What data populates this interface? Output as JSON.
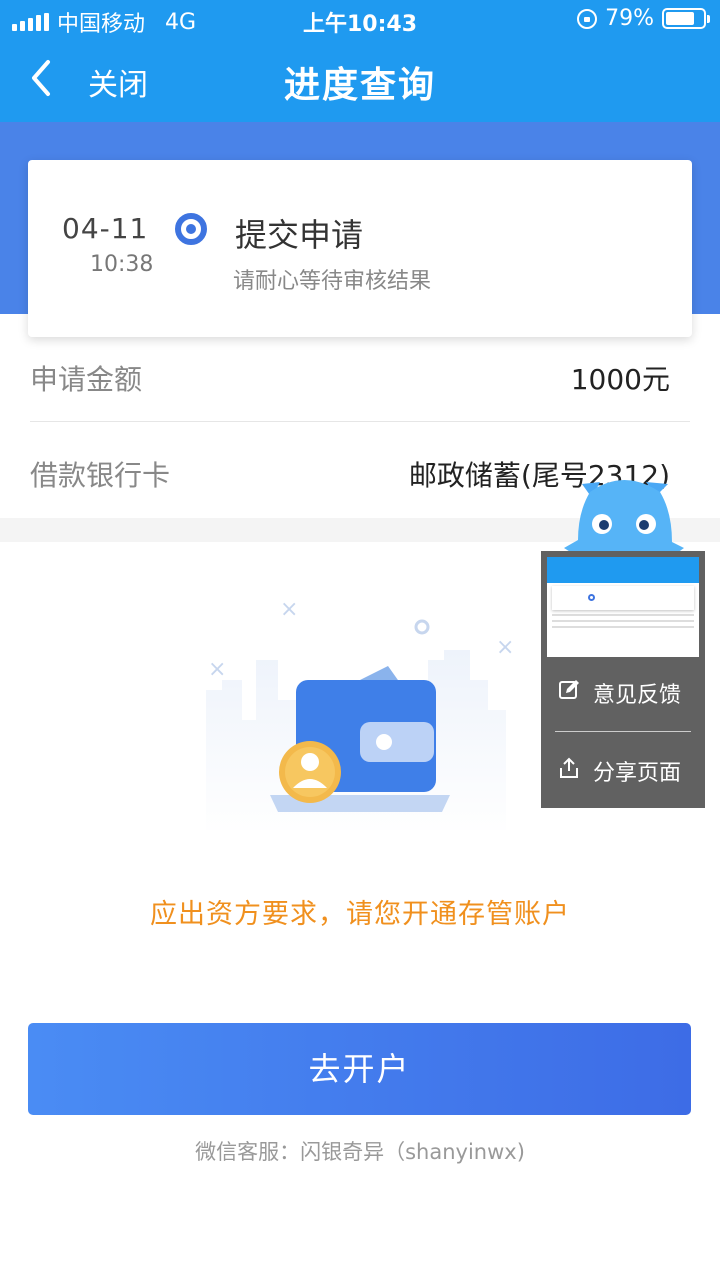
{
  "status": {
    "carrier": "中国移动",
    "network": "4G",
    "time": "上午10:43",
    "battery": "79%",
    "battery_level": 0.79
  },
  "nav": {
    "close_label": "关闭",
    "title": "进度查询"
  },
  "progress": {
    "date": "04-11",
    "time": "10:38",
    "step_title": "提交申请",
    "step_hint": "请耐心等待审核结果"
  },
  "details": [
    {
      "label": "申请金额",
      "value": "1000元"
    },
    {
      "label": "借款银行卡",
      "value": "邮政储蓄(尾号2312)"
    }
  ],
  "notice": "应出资方要求，请您开通存管账户",
  "action_button": "去开户",
  "service": "微信客服：闪银奇异（shanyinwx)",
  "share_panel": {
    "feedback_label": "意见反馈",
    "share_label": "分享页面"
  },
  "colors": {
    "header": "#1f9af0",
    "accent": "#3e74e0",
    "notice": "#f0901e"
  }
}
